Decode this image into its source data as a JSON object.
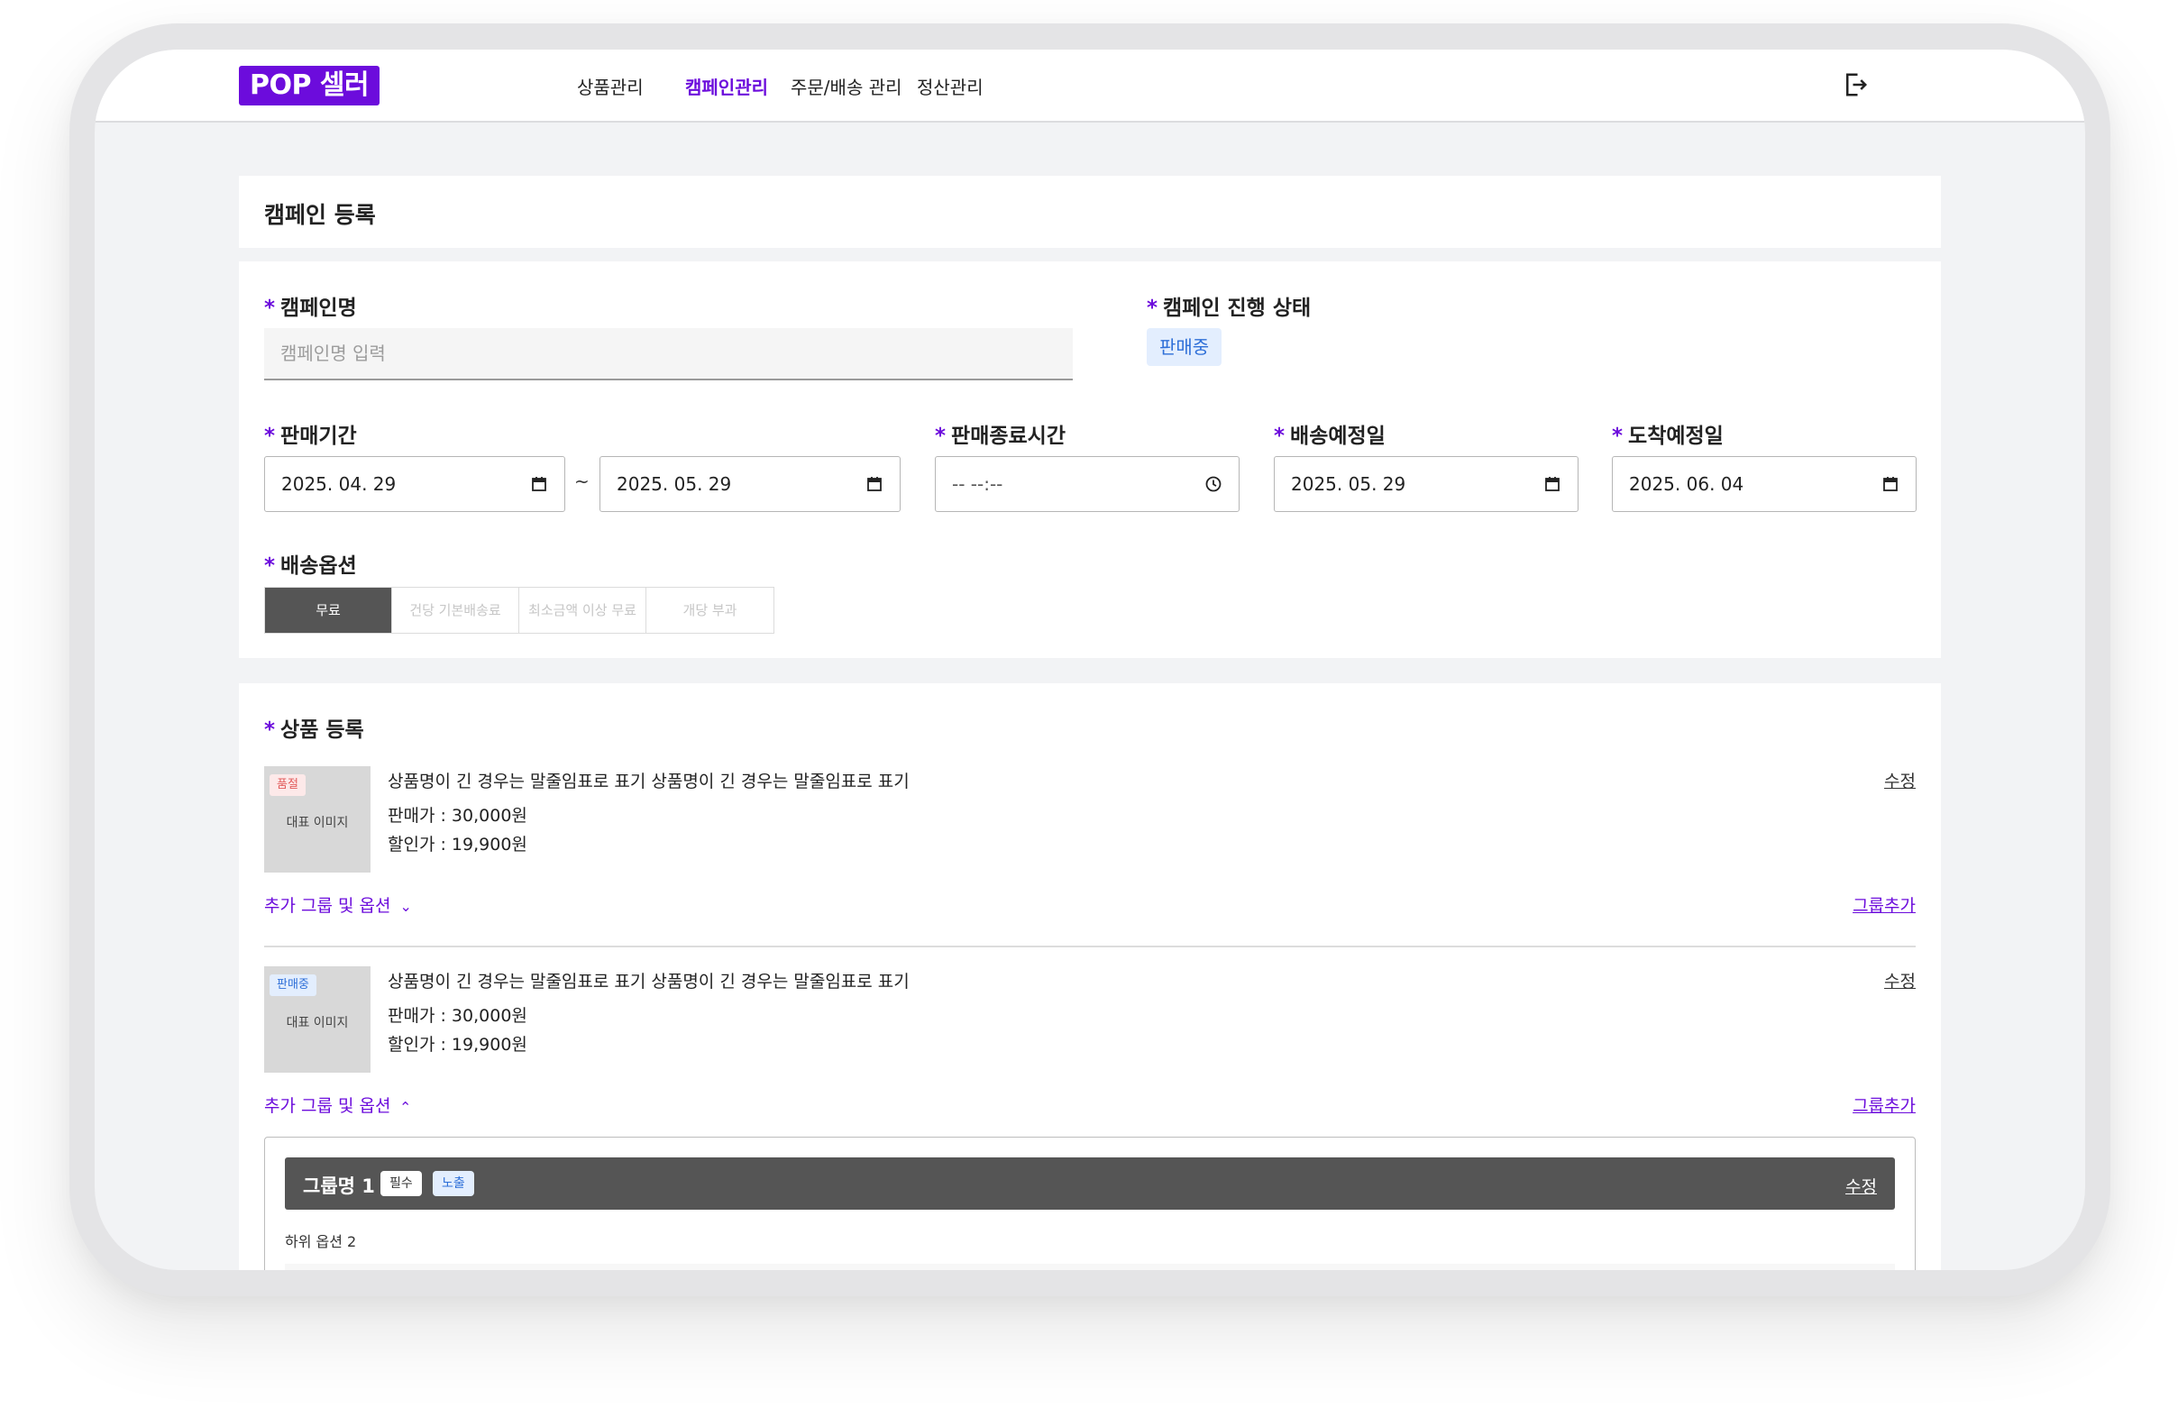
{
  "header": {
    "logo": "POP 셀러",
    "nav": [
      "상품관리",
      "캠페인관리",
      "주문/배송 관리",
      "정산관리"
    ],
    "active_nav": "캠페인관리",
    "logout_icon": "logout-icon"
  },
  "page_title": "캠페인 등록",
  "form": {
    "required_mark": "*",
    "campaign_name": {
      "label": "캠페인명",
      "placeholder": "캠페인명 입력",
      "value": ""
    },
    "campaign_status": {
      "label": "캠페인 진행 상태",
      "value": "판매중"
    },
    "sale_period": {
      "label": "판매기간",
      "start": "2025. 04. 29",
      "separator": "~",
      "end": "2025. 05. 29"
    },
    "sale_end_time": {
      "label": "판매종료시간",
      "value": "-- --:--"
    },
    "ship_date": {
      "label": "배송예정일",
      "value": "2025. 05. 29"
    },
    "arrival_date": {
      "label": "도착예정일",
      "value": "2025. 06. 04"
    },
    "shipping_option": {
      "label": "배송옵션",
      "options": [
        "무료",
        "건당 기본배송료",
        "최소금액 이상 무료",
        "개당 부과"
      ],
      "selected": "무료"
    }
  },
  "products": {
    "label": "상품 등록",
    "items": [
      {
        "tag": "품절",
        "thumb_caption": "대표 이미지",
        "name": "상품명이 긴 경우는 말줄임표로 표기 상품명이 긴 경우는 말줄임표로 표기",
        "price": "판매가 : 30,000원",
        "discount": "할인가 : 19,900원",
        "edit": "수정",
        "options_toggle": "추가 그룹 및 옵션",
        "expanded": false,
        "group_add": "그룹추가"
      },
      {
        "tag": "판매중",
        "thumb_caption": "대표 이미지",
        "name": "상품명이 긴 경우는 말줄임표로 표기 상품명이 긴 경우는 말줄임표로 표기",
        "price": "판매가 : 30,000원",
        "discount": "할인가 : 19,900원",
        "edit": "수정",
        "options_toggle": "추가 그룹 및 옵션",
        "expanded": true,
        "group_add": "그룹추가"
      }
    ],
    "group": {
      "name": "그룹명 1",
      "required_chip": "필수",
      "visible_chip": "노출",
      "edit": "수정",
      "sub_option": "하위 옵션 2"
    }
  },
  "colors": {
    "brand": "#6c0cdc",
    "status_blue": "#2e6fd8",
    "soldout_red": "#e25b5b",
    "dark_gray": "#555555"
  }
}
